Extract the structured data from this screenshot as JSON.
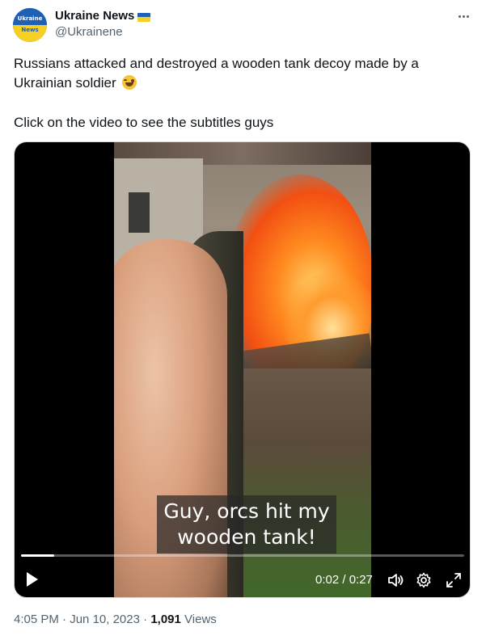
{
  "header": {
    "display_name": "Ukraine News",
    "handle": "@Ukrainene",
    "avatar_text_line1": "Ukraine",
    "avatar_text_line2": "News",
    "flag_icon": "ukraine-flag-icon",
    "more_icon": "more-dots-icon"
  },
  "body": {
    "line1": "Russians attacked and destroyed a wooden tank decoy made by a",
    "line2": "Ukrainian soldier",
    "line2_emoji": "laughing-tears-emoji-icon",
    "line3": "Click on the video to see the subtitles guys"
  },
  "video": {
    "subtitle_line1": "Guy, orcs hit my",
    "subtitle_line2": "wooden tank!",
    "time_display": "0:02 / 0:27",
    "progress_fraction": 0.074,
    "play_icon": "play-icon",
    "volume_icon": "volume-icon",
    "settings_icon": "gear-icon",
    "fullscreen_icon": "fullscreen-icon"
  },
  "footer": {
    "time": "4:05 PM",
    "sep1": " · ",
    "date": "Jun 10, 2023",
    "sep2": " · ",
    "views_count": "1,091",
    "views_label": "Views"
  },
  "colors": {
    "text": "#0f1419",
    "secondary": "#536471",
    "border": "#cfd9de"
  }
}
